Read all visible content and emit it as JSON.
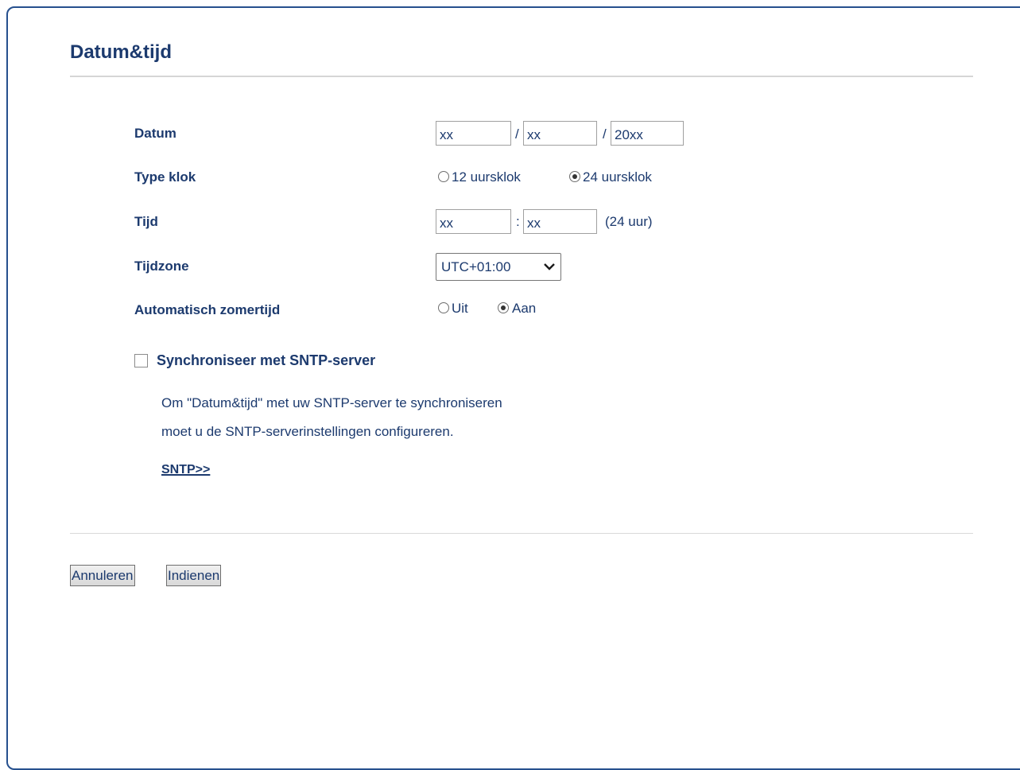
{
  "page": {
    "title": "Datum&tijd"
  },
  "form": {
    "date": {
      "label": "Datum",
      "day": "xx",
      "month": "xx",
      "year": "20xx",
      "separator": "/"
    },
    "clock_type": {
      "label": "Type klok",
      "option_12": "12 uursklok",
      "option_24": "24 uursklok",
      "selected": "24 uursklok"
    },
    "time": {
      "label": "Tijd",
      "hour": "xx",
      "minute": "xx",
      "separator": ":",
      "suffix": "(24 uur)"
    },
    "timezone": {
      "label": "Tijdzone",
      "value": "UTC+01:00"
    },
    "auto_dst": {
      "label": "Automatisch zomertijd",
      "option_off": "Uit",
      "option_on": "Aan",
      "selected": "Aan"
    },
    "sntp": {
      "checkbox_label": "Synchroniseer met SNTP-server",
      "checked": false,
      "help_line1": "Om \"Datum&tijd\" met uw SNTP-server te synchroniseren",
      "help_line2": "moet u de SNTP-serverinstellingen configureren.",
      "link_text": "SNTP>>"
    }
  },
  "buttons": {
    "cancel": "Annuleren",
    "submit": "Indienen"
  },
  "colors": {
    "text": "#1c3a6e",
    "frame": "#26508e"
  }
}
